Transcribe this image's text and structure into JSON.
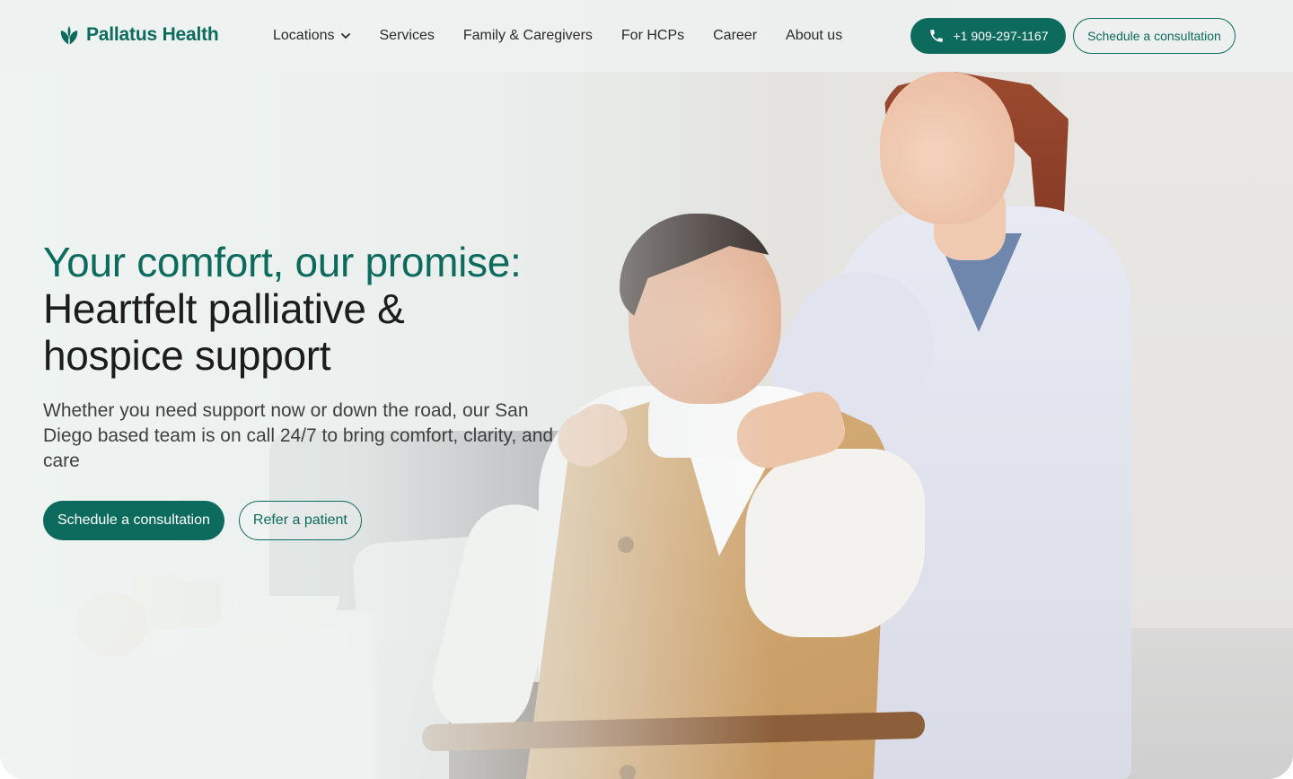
{
  "brand": {
    "name": "Pallatus Health",
    "logo_icon": "leaf-icon",
    "color": "#0d6b5e"
  },
  "nav": {
    "items": [
      {
        "label": "Locations",
        "has_dropdown": true
      },
      {
        "label": "Services"
      },
      {
        "label": "Family & Caregivers"
      },
      {
        "label": "For HCPs"
      },
      {
        "label": "Career"
      },
      {
        "label": "About us"
      }
    ]
  },
  "header_actions": {
    "phone_label": "+1 909-297-1167",
    "phone_icon": "phone-icon",
    "schedule_label": "Schedule a consultation"
  },
  "hero": {
    "headline_accent": "Your comfort, our promise:",
    "headline_main": "Heartfelt palliative & hospice support",
    "subtext": "Whether you need support now or down the road, our San Diego based team is on call 24/7 to bring comfort, clarity, and care",
    "primary_cta": "Schedule a consultation",
    "secondary_cta": "Refer a patient"
  }
}
